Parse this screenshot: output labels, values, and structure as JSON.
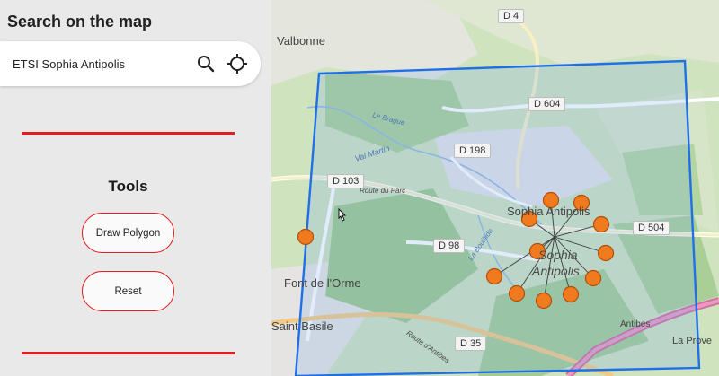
{
  "panel": {
    "title": "Search on the map",
    "search": {
      "value": "ETSI Sophia Antipolis"
    },
    "icons": {
      "search": "search-icon",
      "locate": "crosshair-icon"
    },
    "tools_title": "Tools",
    "draw_polygon_label": "Draw Polygon",
    "reset_label": "Reset",
    "accent_color": "#e02020"
  },
  "map": {
    "places": {
      "valbonne": "Valbonne",
      "sophia_antipolis_top": "Sophia Antipolis",
      "sophia": "Sophia",
      "antipolis": "Antipolis",
      "font_de_lorme": "Font de l'Orme",
      "saint_basile": "Saint Basile",
      "antibes": "Antibes",
      "la_provence": "La Prove"
    },
    "roads": {
      "d4": "D 4",
      "d604": "D 604",
      "d198": "D 198",
      "d103": "D 103",
      "d98": "D 98",
      "d504": "D 504",
      "d35": "D 35"
    },
    "streets": {
      "route_du_parc": "Route du Parc",
      "val_martin": "Val Martin",
      "la_bouillide": "La Bouillide",
      "le_brague": "Le Brague",
      "route_dantibes": "Route d'Antibes"
    },
    "polygon_color": "#1f6fe8",
    "marker_color": "#f07a1e",
    "marker_count": 13
  }
}
